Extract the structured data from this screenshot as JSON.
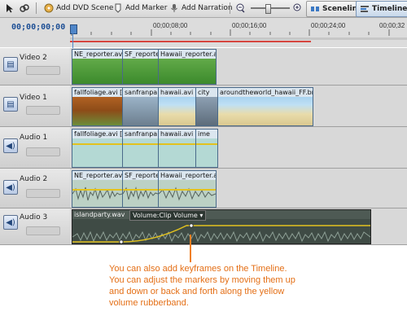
{
  "toolbar": {
    "add_dvd_scene": "Add DVD Scene",
    "add_marker": "Add Marker",
    "add_narration": "Add Narration",
    "sceneline": "Sceneline",
    "timeline": "Timeline"
  },
  "ruler": {
    "timecode": "00;00;00;00",
    "ticks": [
      "00;00;08;00",
      "00;00;16;00",
      "00;00;24;00",
      "00;00;32"
    ]
  },
  "tracks": {
    "video2": {
      "name": "Video 2",
      "clips": [
        "NE_reporter.avi",
        "SF_reporte",
        "Hawaii_reporter.avi"
      ]
    },
    "video1": {
      "name": "Video 1",
      "clips": [
        "fallfoliage.avi [V]",
        "sanfranpair",
        "hawaii.avi [V]",
        "city",
        "aroundtheworld_hawaii_FF.bmp"
      ]
    },
    "audio1": {
      "name": "Audio 1",
      "clips": [
        "fallfoliage.avi [A]",
        "sanfranpair",
        "hawaii.avi [A]",
        "ime"
      ]
    },
    "audio2": {
      "name": "Audio 2",
      "clips": [
        "NE_reporter.avi",
        "SF_reporte",
        "Hawaii_reporter.avi"
      ]
    },
    "audio3": {
      "name": "Audio 3",
      "clips": [
        "islandparty.wav",
        "Volume:Clip Volume"
      ]
    }
  },
  "callout": {
    "text": "You can also add keyframes on the Timeline. You can adjust the markers by moving them up and down or back and forth along the yellow volume rubberband."
  },
  "colors": {
    "callout": "#e46f16",
    "rubberband": "#e3c21e",
    "timecode": "#1d4f95",
    "playhead_bar": "#d6453f"
  }
}
